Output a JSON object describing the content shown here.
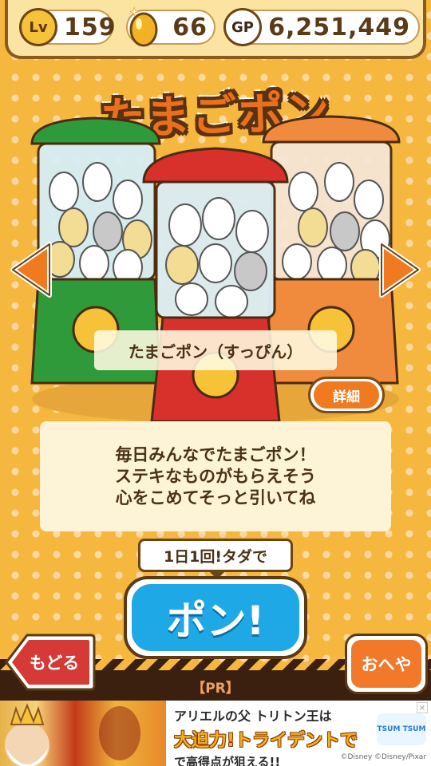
{
  "status": {
    "level_label": "Lv",
    "level": "159",
    "eggs": "66",
    "gp_label": "GP",
    "gp": "6,251,449"
  },
  "title": "たまごポン",
  "machine_name": "たまごポン（すっぴん）",
  "detail_label": "詳細",
  "description": [
    "毎日みんなでたまごポン！",
    "ステキなものがもらえそう",
    "心をこめてそっと引いてね"
  ],
  "free_callout": "1日1回!タダで",
  "pon_button": "ポン!",
  "back_button": "もどる",
  "room_button": "おへや",
  "pr_label": "【PR】",
  "ad": {
    "line1": "アリエルの父 トリトン王は",
    "line2": "大迫力!トライデントで",
    "line3": "で高得点が狙える!!",
    "logo_label": "TSUM TSUM",
    "copyright": "©Disney ©Disney/Pixar",
    "close": "×"
  },
  "colors": {
    "machine_left": "#2e9a3a",
    "machine_center": "#d8312c",
    "machine_right": "#f08a3c",
    "pon_button": "#1ea8e6",
    "arrow": "#ef7a1f"
  },
  "icons": {
    "egg": "golden-egg-icon",
    "left": "left-arrow-icon",
    "right": "right-arrow-icon"
  }
}
